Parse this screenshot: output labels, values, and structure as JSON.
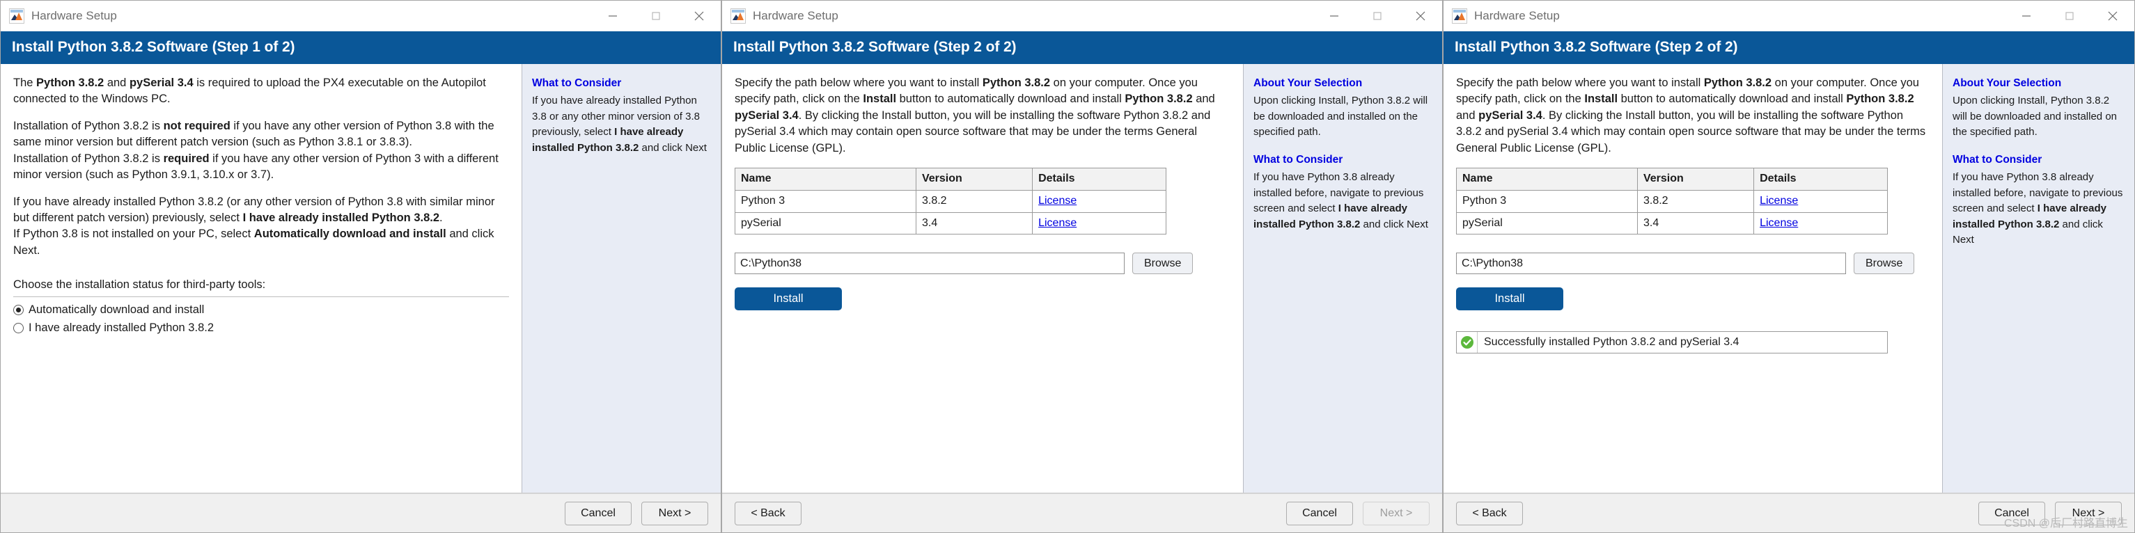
{
  "windows": [
    {
      "titlebar": {
        "title": "Hardware Setup",
        "icon": "matlab-icon",
        "minimize": "minimize-icon",
        "maximize": "maximize-icon",
        "close": "close-icon"
      },
      "banner": "Install Python 3.8.2 Software (Step 1 of 2)",
      "body": {
        "p1_a": "The ",
        "p1_b1": "Python 3.8.2",
        "p1_c": " and ",
        "p1_b2": "pySerial 3.4",
        "p1_d": " is required to upload the PX4 executable on the Autopilot connected to the Windows PC.",
        "p2_a": "Installation of Python 3.8.2 is ",
        "p2_b1": "not required",
        "p2_c": " if you have any other version of Python 3.8 with the same minor version but different patch version (such as Python 3.8.1 or 3.8.3).",
        "p3_a": "Installation of Python 3.8.2 is ",
        "p3_b1": "required",
        "p3_c": " if you have any other version of Python 3 with a different minor version (such as Python 3.9.1, 3.10.x or 3.7).",
        "p4_a": "If you have already installed Python 3.8.2 (or any other version of Python 3.8 with similar minor but different patch version) previously, select ",
        "p4_b1": "I have already installed Python 3.8.2",
        "p4_c": ".",
        "p5_a": "If Python 3.8 is not installed on your PC, select ",
        "p5_b1": "Automatically download and install",
        "p5_c": " and click Next."
      },
      "radio_group": {
        "label": "Choose the installation status for third-party tools:",
        "options": [
          {
            "label": "Automatically download and install",
            "selected": true
          },
          {
            "label": "I have already installed Python 3.8.2",
            "selected": false
          }
        ]
      },
      "sidebar": [
        {
          "heading": "What to Consider",
          "a": "If you have already installed Python 3.8 or any other minor version of 3.8 previously, select ",
          "b": "I have already installed Python 3.8.2",
          "c": " and click Next"
        }
      ],
      "footer": {
        "back": null,
        "cancel": "Cancel",
        "next": "Next >",
        "next_disabled": false
      }
    },
    {
      "titlebar": {
        "title": "Hardware Setup",
        "icon": "matlab-icon",
        "minimize": "minimize-icon",
        "maximize": "maximize-icon",
        "close": "close-icon"
      },
      "banner": "Install Python 3.8.2 Software (Step 2 of 2)",
      "body": {
        "a1": "Specify the path below where you want to install ",
        "b1": "Python 3.8.2",
        "a2": " on your computer. Once you specify path, click on the ",
        "b2": "Install",
        "a3": " button to automatically download and install ",
        "b3": "Python 3.8.2",
        "a4": " and ",
        "b4": "pySerial 3.4",
        "a5": ". By clicking the Install button, you will be installing the software Python 3.8.2 and pySerial 3.4 which may contain open source software that may be under the terms General Public License (GPL)."
      },
      "table": {
        "headers": [
          "Name",
          "Version",
          "Details"
        ],
        "rows": [
          [
            "Python 3",
            "3.8.2",
            "License"
          ],
          [
            "pySerial",
            "3.4",
            "License"
          ]
        ]
      },
      "path": {
        "value": "C:\\Python38",
        "browse_label": "Browse"
      },
      "install_label": "Install",
      "status": null,
      "sidebar": [
        {
          "heading": "About Your Selection",
          "a": "Upon clicking Install, Python 3.8.2 will be downloaded and installed on the specified path.",
          "b": "",
          "c": ""
        },
        {
          "heading": "What to Consider",
          "a": "If you have Python 3.8 already installed before, navigate to previous screen and select ",
          "b": "I have already installed Python 3.8.2",
          "c": " and click Next"
        }
      ],
      "footer": {
        "back": "< Back",
        "cancel": "Cancel",
        "next": "Next >",
        "next_disabled": true
      }
    },
    {
      "titlebar": {
        "title": "Hardware Setup",
        "icon": "matlab-icon",
        "minimize": "minimize-icon",
        "maximize": "maximize-icon",
        "close": "close-icon"
      },
      "banner": "Install Python 3.8.2 Software (Step 2 of 2)",
      "body": {
        "a1": "Specify the path below where you want to install ",
        "b1": "Python 3.8.2",
        "a2": " on your computer. Once you specify path, click on the ",
        "b2": "Install",
        "a3": " button to automatically download and install ",
        "b3": "Python 3.8.2",
        "a4": " and ",
        "b4": "pySerial 3.4",
        "a5": ". By clicking the Install button, you will be installing the software Python 3.8.2 and pySerial 3.4 which may contain open source software that may be under the terms General Public License (GPL)."
      },
      "table": {
        "headers": [
          "Name",
          "Version",
          "Details"
        ],
        "rows": [
          [
            "Python 3",
            "3.8.2",
            "License"
          ],
          [
            "pySerial",
            "3.4",
            "License"
          ]
        ]
      },
      "path": {
        "value": "C:\\Python38",
        "browse_label": "Browse"
      },
      "install_label": "Install",
      "status": {
        "icon": "success-check-icon",
        "text": "Successfully installed Python 3.8.2 and pySerial 3.4"
      },
      "sidebar": [
        {
          "heading": "About Your Selection",
          "a": "Upon clicking Install, Python 3.8.2 will be downloaded and installed on the specified path.",
          "b": "",
          "c": ""
        },
        {
          "heading": "What to Consider",
          "a": "If you have Python 3.8 already installed before, navigate to previous screen and select ",
          "b": "I have already installed Python 3.8.2",
          "c": " and click Next"
        }
      ],
      "footer": {
        "back": "< Back",
        "cancel": "Cancel",
        "next": "Next >",
        "next_disabled": false
      }
    }
  ],
  "watermark": "CSDN @后厂村路直博生",
  "colors": {
    "banner_blue": "#0a5798",
    "sidebar_bg": "#e8ecf5",
    "link_blue": "#0000e0",
    "success_green": "#5cb83c"
  }
}
